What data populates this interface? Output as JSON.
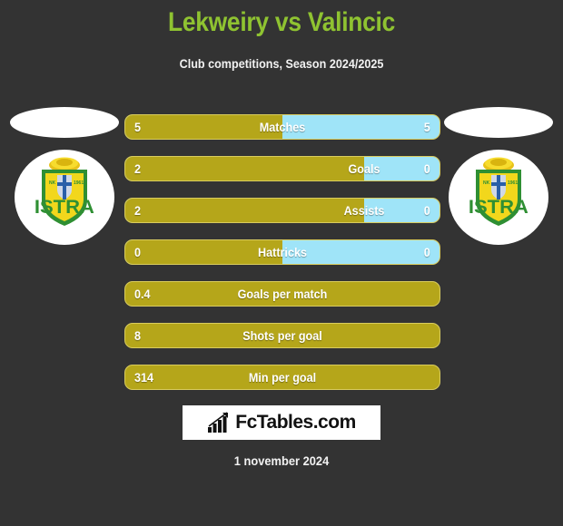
{
  "header": {
    "title": "Lekweiry vs Valincic",
    "subtitle": "Club competitions, Season 2024/2025"
  },
  "colors": {
    "background": "#333333",
    "title_green": "#8fc331",
    "home_bar": "#b5a61a",
    "away_bar": "#9fe4f8",
    "bar_border": "#d9cc5e",
    "text": "#ffffff"
  },
  "teams": {
    "home": {
      "badge_name": "istra-1961-crest",
      "badge_text": "ISTRA"
    },
    "away": {
      "badge_name": "istra-1961-crest",
      "badge_text": "ISTRA"
    }
  },
  "stats": [
    {
      "label": "Matches",
      "home": "5",
      "away": "5",
      "home_pct": 50,
      "has_away": true
    },
    {
      "label": "Goals",
      "home": "2",
      "away": "0",
      "home_pct": 76,
      "has_away": true
    },
    {
      "label": "Assists",
      "home": "2",
      "away": "0",
      "home_pct": 76,
      "has_away": true
    },
    {
      "label": "Hattricks",
      "home": "0",
      "away": "0",
      "home_pct": 50,
      "has_away": true
    },
    {
      "label": "Goals per match",
      "home": "0.4",
      "away": "",
      "home_pct": 100,
      "has_away": false
    },
    {
      "label": "Shots per goal",
      "home": "8",
      "away": "",
      "home_pct": 100,
      "has_away": false
    },
    {
      "label": "Min per goal",
      "home": "314",
      "away": "",
      "home_pct": 100,
      "has_away": false
    }
  ],
  "logo": {
    "text": "FcTables.com",
    "icon": "bar-chart-arrow-icon"
  },
  "footer": {
    "date": "1 november 2024"
  }
}
